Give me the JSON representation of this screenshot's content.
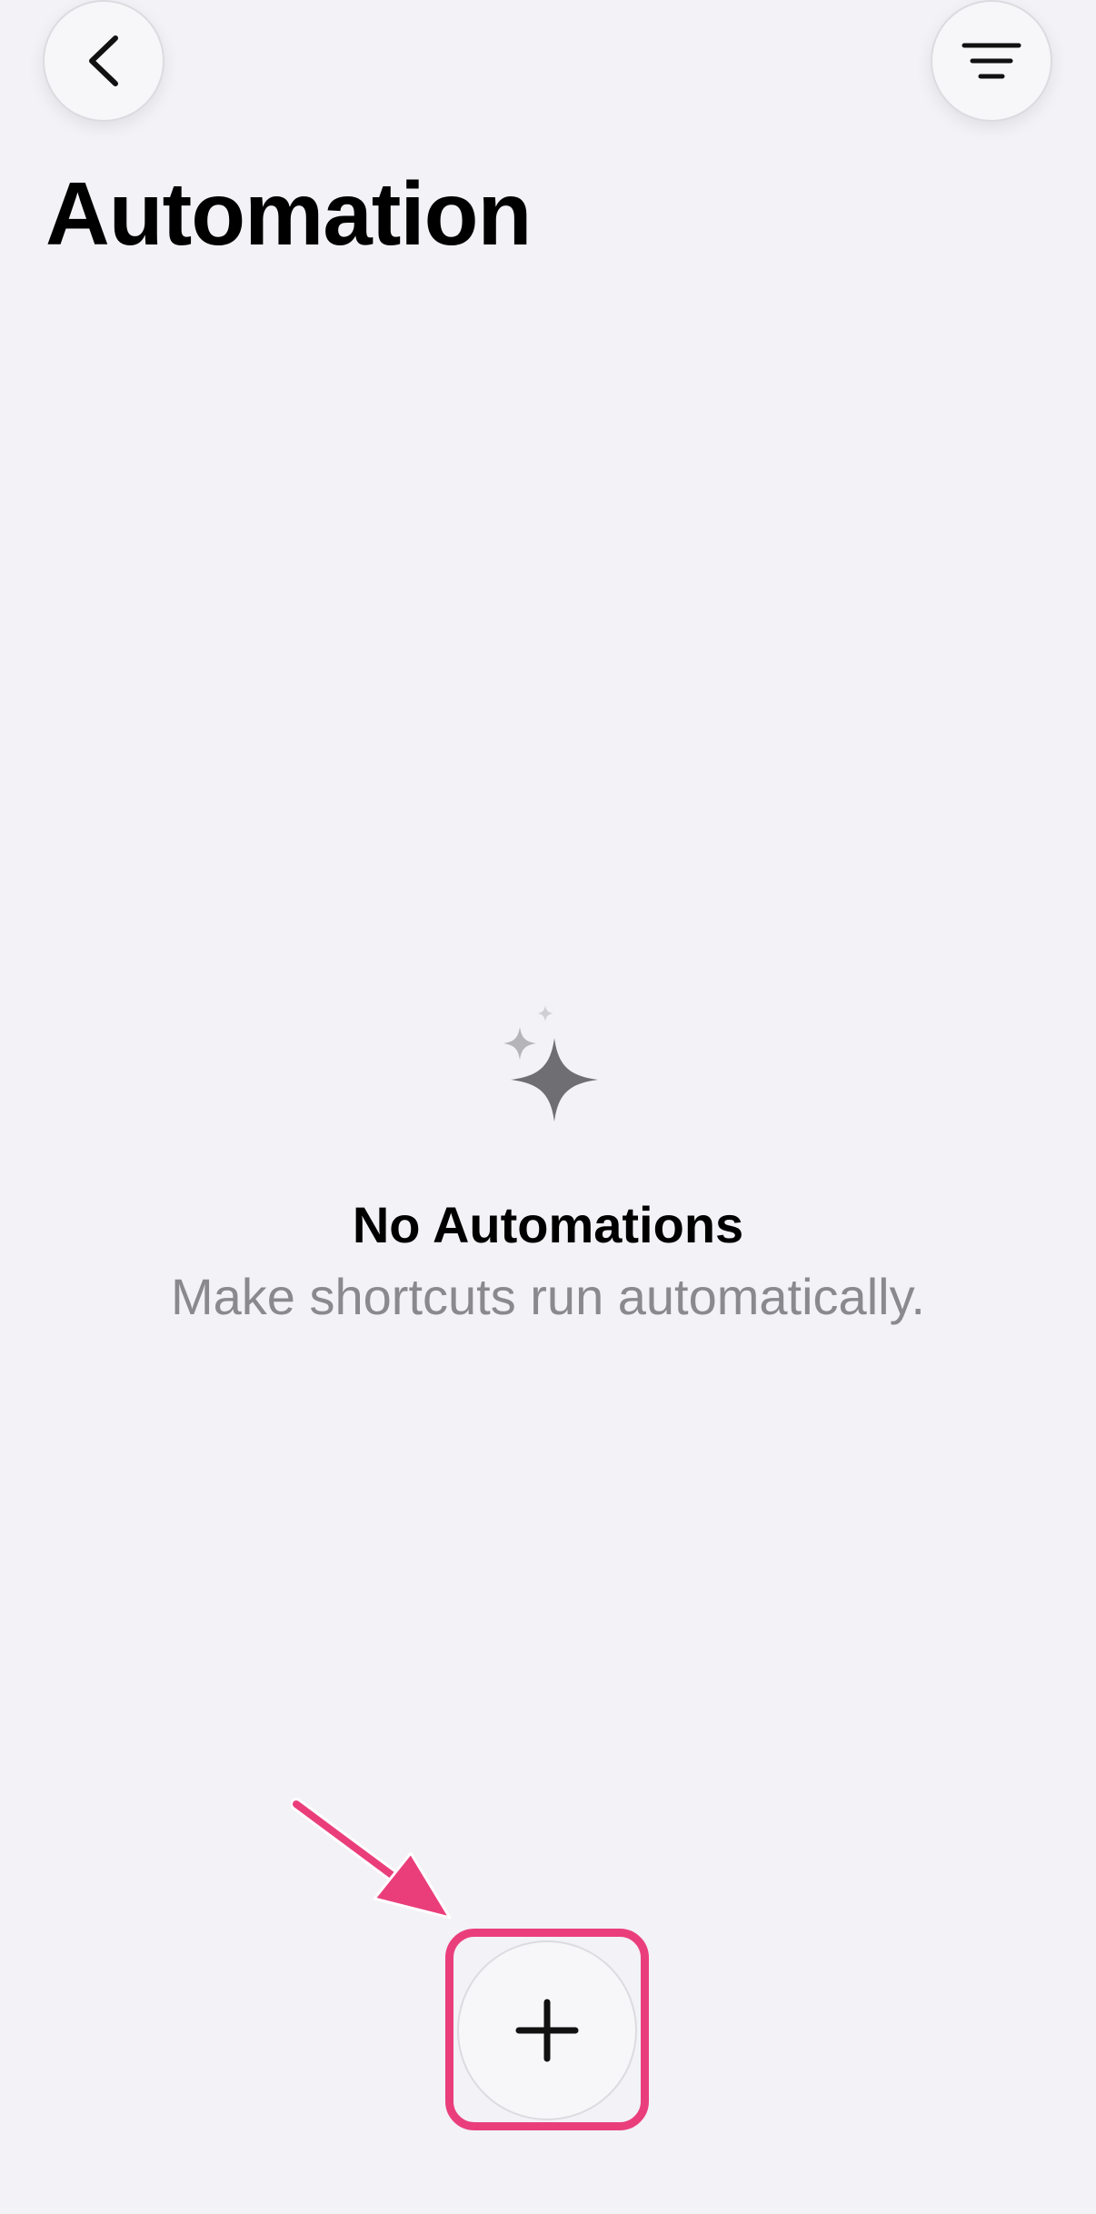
{
  "header": {
    "back_icon": "chevron-left-icon",
    "menu_icon": "filter-lines-icon",
    "title": "Automation"
  },
  "empty_state": {
    "icon": "sparkles-icon",
    "title": "No Automations",
    "subtitle": "Make shortcuts run automatically."
  },
  "add_button": {
    "icon": "plus-icon"
  },
  "annotation": {
    "arrow_color": "#ea3e7b",
    "highlight_color": "#ea3e7b"
  }
}
